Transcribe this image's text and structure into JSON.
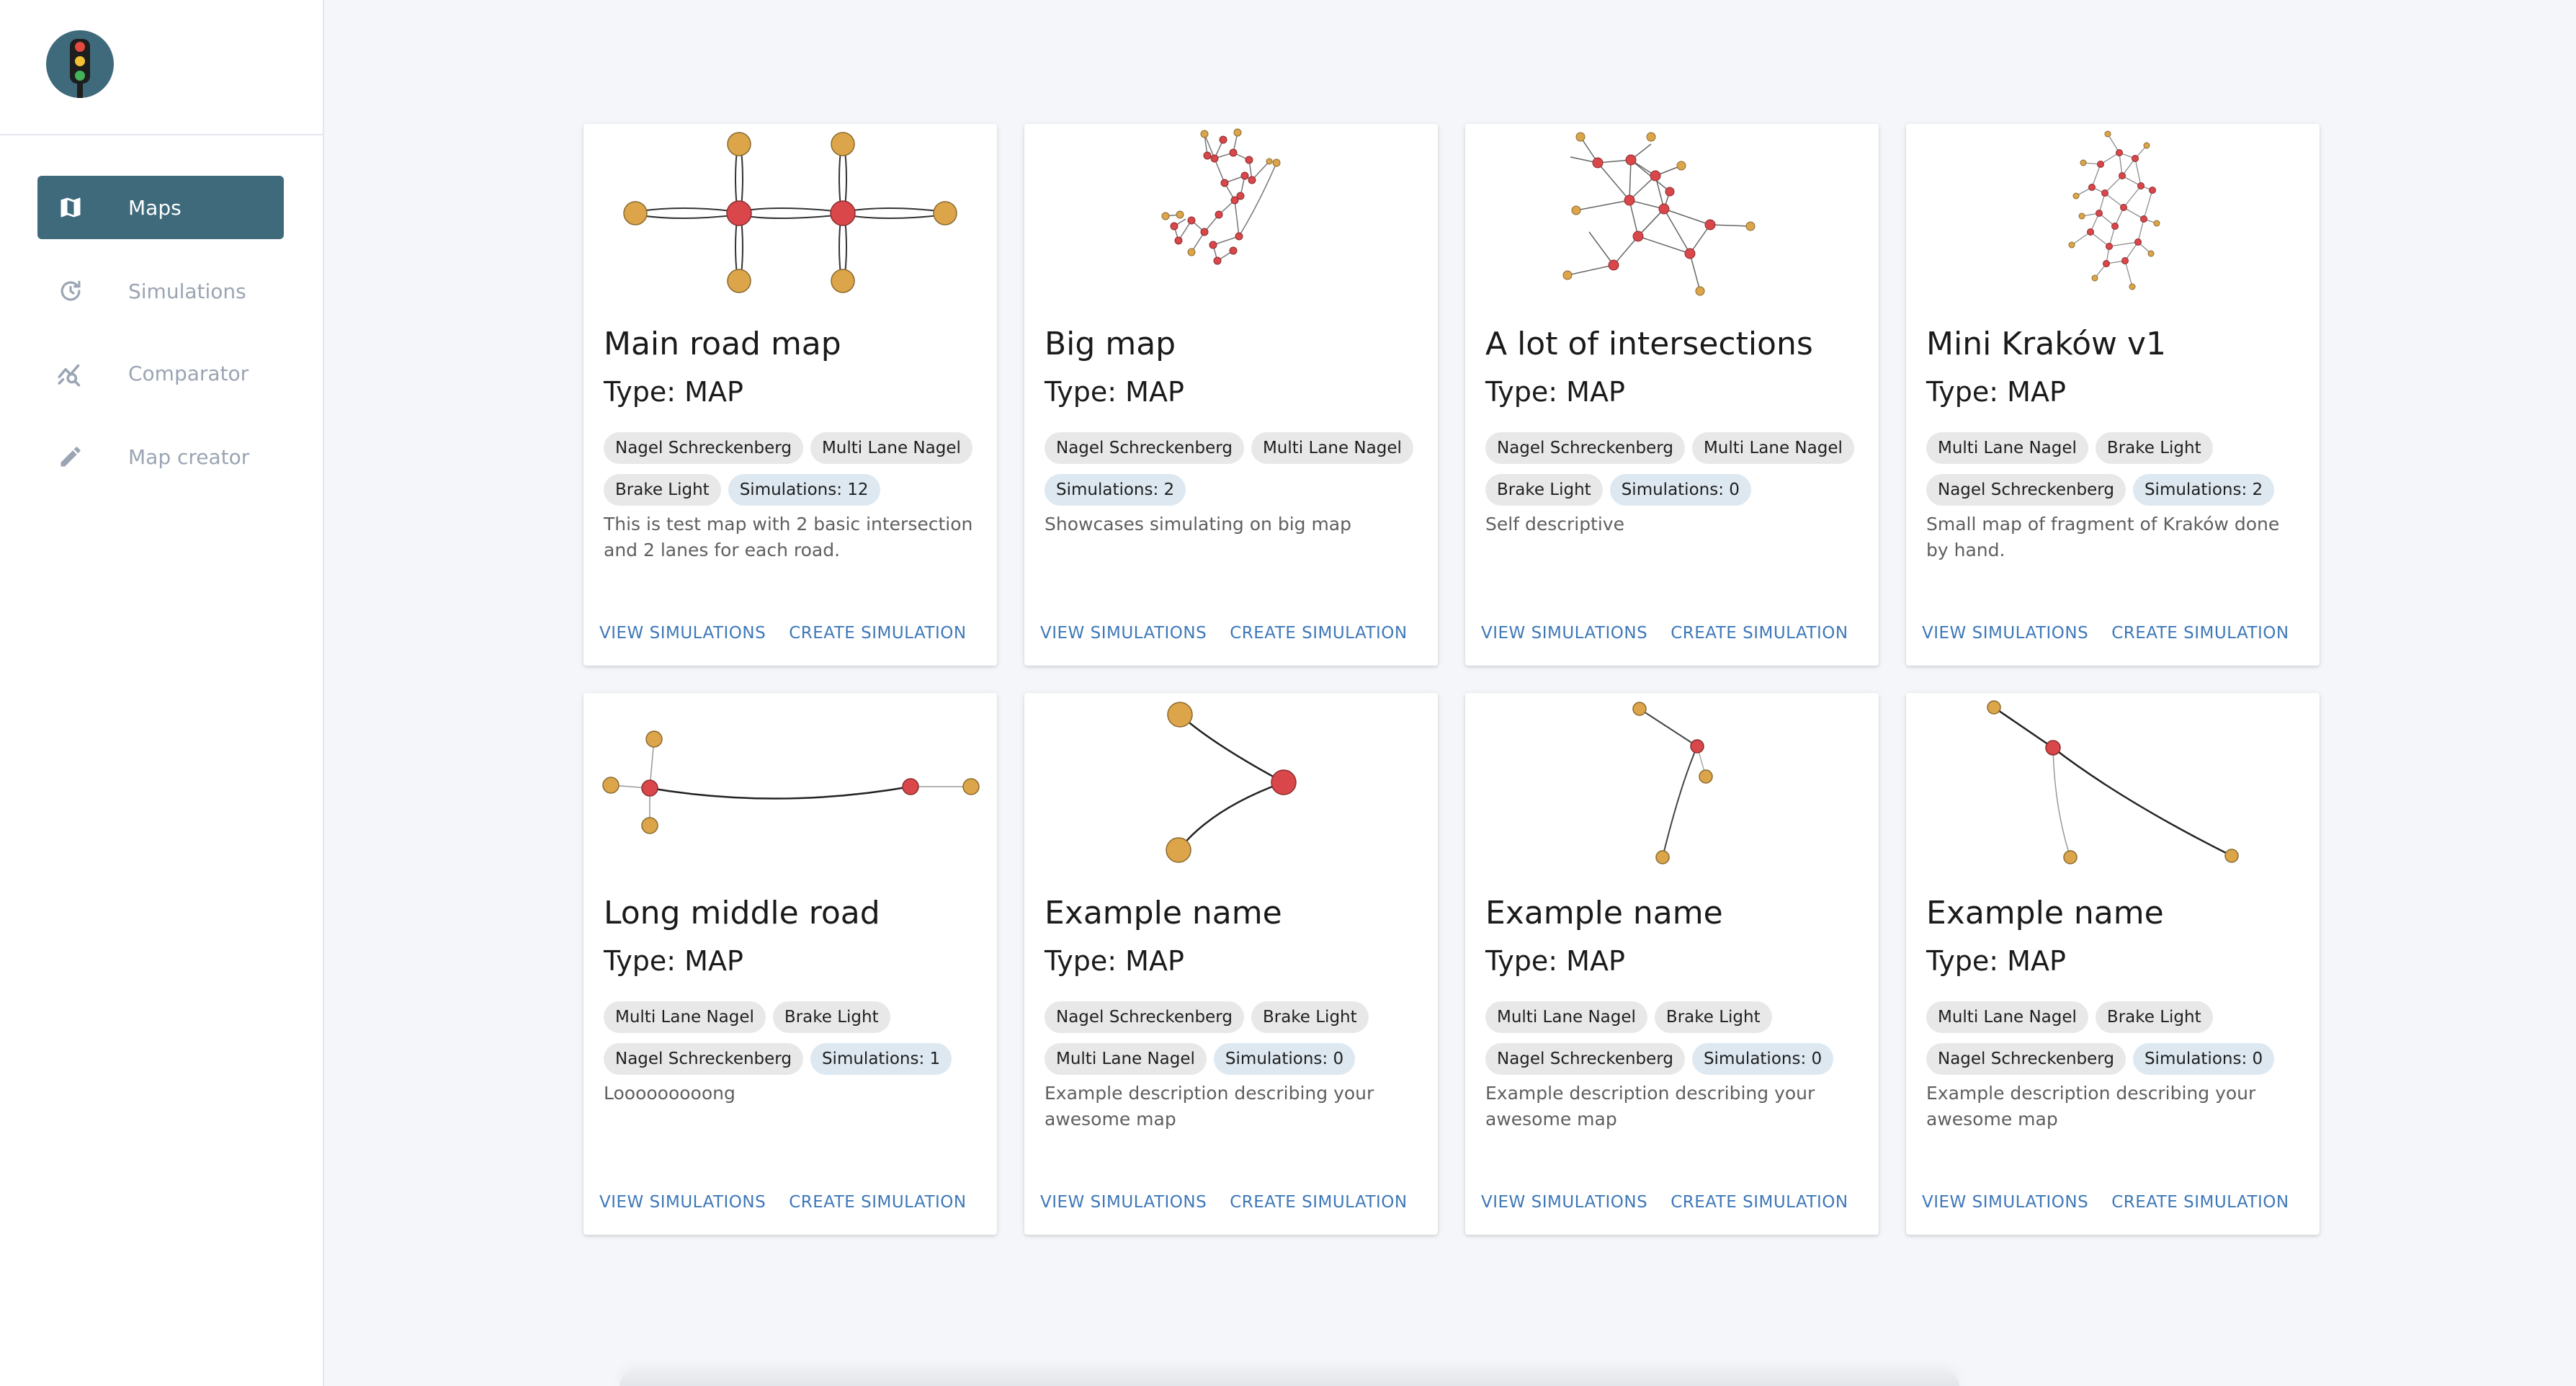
{
  "sidebar": {
    "items": [
      {
        "label": "Maps",
        "icon": "map-icon",
        "active": true
      },
      {
        "label": "Simulations",
        "icon": "history-icon",
        "active": false
      },
      {
        "label": "Comparator",
        "icon": "chart-search-icon",
        "active": false
      },
      {
        "label": "Map creator",
        "icon": "pencil-icon",
        "active": false
      }
    ]
  },
  "colors": {
    "accent": "#3e6a7c",
    "link": "#3e78b8",
    "node_orange": "#dca54a",
    "node_red": "#d9474a"
  },
  "cards": [
    {
      "title": "Main road map",
      "type": "Type: MAP",
      "chips_row1": [
        "Nagel Schreckenberg",
        "Multi Lane Nagel"
      ],
      "chips_row2": [
        "Brake Light"
      ],
      "sims": "Simulations: 12",
      "description": "This is test map with 2 basic intersection and 2 lanes for each road.",
      "view": "VIEW SIMULATIONS",
      "create": "CREATE SIMULATION"
    },
    {
      "title": "Big map",
      "type": "Type: MAP",
      "chips_row1": [
        "Nagel Schreckenberg",
        "Multi Lane Nagel"
      ],
      "chips_row2": [],
      "sims": "Simulations: 2",
      "description": "Showcases simulating on big map",
      "view": "VIEW SIMULATIONS",
      "create": "CREATE SIMULATION"
    },
    {
      "title": "A lot of intersections",
      "type": "Type: MAP",
      "chips_row1": [
        "Nagel Schreckenberg",
        "Multi Lane Nagel"
      ],
      "chips_row2": [
        "Brake Light"
      ],
      "sims": "Simulations: 0",
      "description": "Self descriptive",
      "view": "VIEW SIMULATIONS",
      "create": "CREATE SIMULATION"
    },
    {
      "title": "Mini Kraków v1",
      "type": "Type: MAP",
      "chips_row1": [
        "Multi Lane Nagel",
        "Brake Light"
      ],
      "chips_row2": [
        "Nagel Schreckenberg"
      ],
      "sims": "Simulations: 2",
      "description": "Small map of fragment of Kraków done by hand.",
      "view": "VIEW SIMULATIONS",
      "create": "CREATE SIMULATION"
    },
    {
      "title": "Long middle road",
      "type": "Type: MAP",
      "chips_row1": [
        "Multi Lane Nagel",
        "Brake Light"
      ],
      "chips_row2": [
        "Nagel Schreckenberg"
      ],
      "sims": "Simulations: 1",
      "description": "Looooooooong",
      "view": "VIEW SIMULATIONS",
      "create": "CREATE SIMULATION"
    },
    {
      "title": "Example name",
      "type": "Type: MAP",
      "chips_row1": [
        "Nagel Schreckenberg",
        "Brake Light"
      ],
      "chips_row2": [
        "Multi Lane Nagel"
      ],
      "sims": "Simulations: 0",
      "description": "Example description describing your awesome map",
      "view": "VIEW SIMULATIONS",
      "create": "CREATE SIMULATION"
    },
    {
      "title": "Example name",
      "type": "Type: MAP",
      "chips_row1": [
        "Multi Lane Nagel",
        "Brake Light"
      ],
      "chips_row2": [
        "Nagel Schreckenberg"
      ],
      "sims": "Simulations: 0",
      "description": "Example description describing your awesome map",
      "view": "VIEW SIMULATIONS",
      "create": "CREATE SIMULATION"
    },
    {
      "title": "Example name",
      "type": "Type: MAP",
      "chips_row1": [
        "Multi Lane Nagel",
        "Brake Light"
      ],
      "chips_row2": [
        "Nagel Schreckenberg"
      ],
      "sims": "Simulations: 0",
      "description": "Example description describing your awesome map",
      "view": "VIEW SIMULATIONS",
      "create": "CREATE SIMULATION"
    }
  ]
}
